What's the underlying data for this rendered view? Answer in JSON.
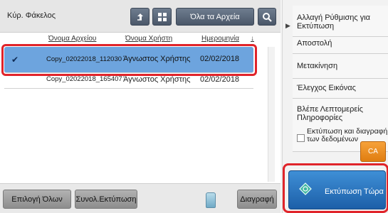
{
  "toolbar": {
    "current_folder": "Κύρ. Φάκελος",
    "all_files_label": "Όλα τα Αρχεία",
    "icons": [
      "up-folder-icon",
      "thumbnail-view-icon",
      "search-icon"
    ]
  },
  "file_list": {
    "columns": [
      "Όνομα Αρχείου",
      "Όνομα Χρήστη",
      "Ημερομηνία"
    ],
    "rows": [
      {
        "name": "Copy_02022018_112030",
        "user": "Άγνωστος Χρήστης",
        "date": "02/02/2018",
        "selected": true
      },
      {
        "name": "Copy_02022018_165407",
        "user": "Άγνωστος Χρήστης",
        "date": "02/02/2018",
        "selected": false
      }
    ]
  },
  "bottom_bar": {
    "select_all": "Επιλογή Όλων",
    "batch_print": "Συνολ.Εκτύπωση",
    "delete": "Διαγραφή"
  },
  "actions": {
    "items": [
      "Αλλαγή Ρύθμισης για Εκτύπωση",
      "Αποστολή",
      "Μετακίνηση",
      "Έλεγχος Εικόνας",
      "Βλέπε Λεπτομερείς Πληροφορίες"
    ],
    "print_and_delete": "Εκτύπωση και διαγραφή των δεδομένων",
    "ca": "CA",
    "print_now": "Εκτύπωση Τώρα"
  },
  "colors": {
    "selected_row": "#6da4de",
    "highlight": "#e0242a",
    "print_now": "#2a74c0",
    "ca": "#ee8f22"
  }
}
